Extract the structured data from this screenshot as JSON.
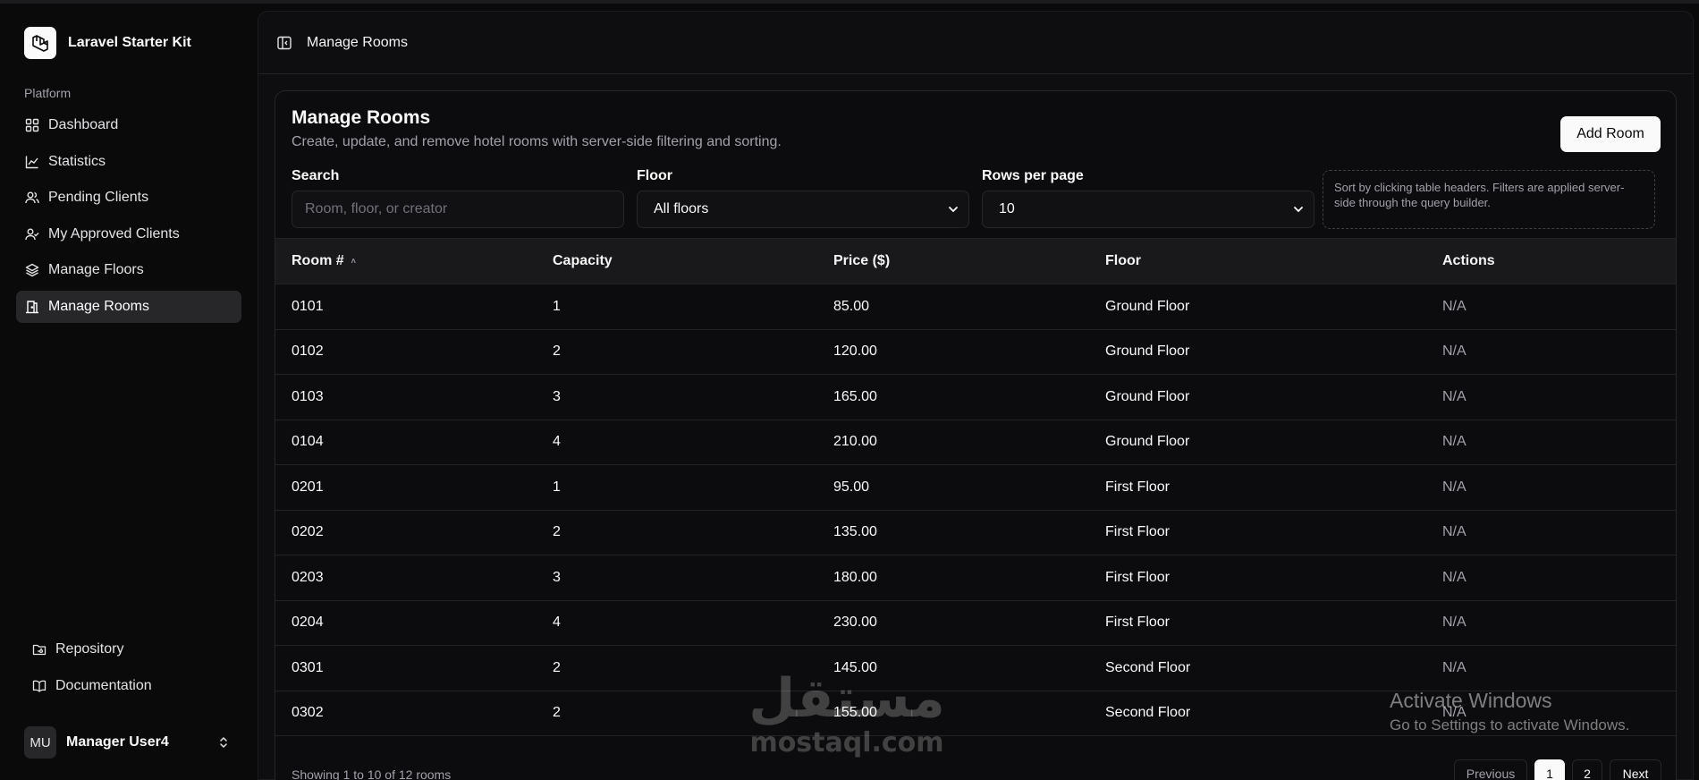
{
  "app": {
    "name": "Laravel Starter Kit"
  },
  "sidebar": {
    "group_label": "Platform",
    "items": [
      {
        "label": "Dashboard",
        "icon": "dashboard-icon"
      },
      {
        "label": "Statistics",
        "icon": "chart-icon"
      },
      {
        "label": "Pending Clients",
        "icon": "users-icon"
      },
      {
        "label": "My Approved Clients",
        "icon": "user-check-icon"
      },
      {
        "label": "Manage Floors",
        "icon": "layers-icon"
      },
      {
        "label": "Manage Rooms",
        "icon": "door-icon",
        "active": true
      }
    ],
    "footer_items": [
      {
        "label": "Repository",
        "icon": "folder-git-icon"
      },
      {
        "label": "Documentation",
        "icon": "book-icon"
      }
    ],
    "user": {
      "initials": "MU",
      "name": "Manager User4"
    }
  },
  "header": {
    "breadcrumb": "Manage Rooms"
  },
  "page": {
    "title": "Manage Rooms",
    "subtitle": "Create, update, and remove hotel rooms with server-side filtering and sorting.",
    "add_button": "Add Room"
  },
  "filters": {
    "search": {
      "label": "Search",
      "placeholder": "Room, floor, or creator",
      "value": ""
    },
    "floor": {
      "label": "Floor",
      "value": "All floors"
    },
    "rows_per_page": {
      "label": "Rows per page",
      "value": "10"
    },
    "hint": "Sort by clicking table headers. Filters are applied server-side through the query builder."
  },
  "table": {
    "columns": [
      "Room #",
      "Capacity",
      "Price ($)",
      "Floor",
      "Actions"
    ],
    "sort_indicator": "˄",
    "rows": [
      [
        "0101",
        "1",
        "85.00",
        "Ground Floor",
        "N/A"
      ],
      [
        "0102",
        "2",
        "120.00",
        "Ground Floor",
        "N/A"
      ],
      [
        "0103",
        "3",
        "165.00",
        "Ground Floor",
        "N/A"
      ],
      [
        "0104",
        "4",
        "210.00",
        "Ground Floor",
        "N/A"
      ],
      [
        "0201",
        "1",
        "95.00",
        "First Floor",
        "N/A"
      ],
      [
        "0202",
        "2",
        "135.00",
        "First Floor",
        "N/A"
      ],
      [
        "0203",
        "3",
        "180.00",
        "First Floor",
        "N/A"
      ],
      [
        "0204",
        "4",
        "230.00",
        "First Floor",
        "N/A"
      ],
      [
        "0301",
        "2",
        "145.00",
        "Second Floor",
        "N/A"
      ],
      [
        "0302",
        "2",
        "155.00",
        "Second Floor",
        "N/A"
      ]
    ]
  },
  "pagination": {
    "showing": "Showing 1 to 10 of 12 rooms",
    "previous": "Previous",
    "pages": [
      "1",
      "2"
    ],
    "current_page": "1",
    "next": "Next"
  },
  "overlays": {
    "watermark_arabic": "مستقل",
    "watermark_latin": "mostaql.com",
    "activate_title": "Activate Windows",
    "activate_sub": "Go to Settings to activate Windows."
  },
  "colors": {
    "background": "#0a0a0a",
    "panel": "#0e0e10",
    "accent_button": "#fafafa",
    "active_nav": "#27272a"
  }
}
